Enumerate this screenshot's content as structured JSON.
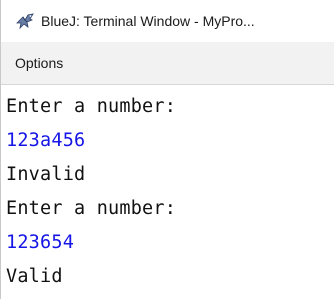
{
  "window": {
    "title": "BlueJ: Terminal Window - MyPro...",
    "icon": "bluej-bird-icon"
  },
  "menubar": {
    "items": [
      {
        "label": "Options"
      }
    ]
  },
  "terminal": {
    "lines": [
      {
        "kind": "output",
        "text": "Enter a number:"
      },
      {
        "kind": "input",
        "text": "123a456"
      },
      {
        "kind": "output",
        "text": "Invalid"
      },
      {
        "kind": "output",
        "text": "Enter a number:"
      },
      {
        "kind": "input",
        "text": "123654"
      },
      {
        "kind": "output",
        "text": "Valid"
      }
    ],
    "colors": {
      "output": "#111111",
      "input": "#1515e6"
    }
  }
}
